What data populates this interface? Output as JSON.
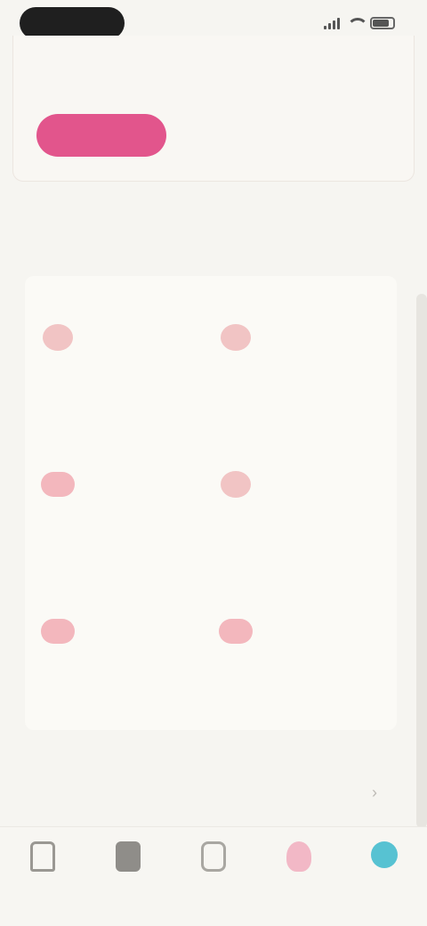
{
  "status_bar": {
    "icons": [
      "signal-icon",
      "wifi-icon",
      "battery-icon"
    ]
  },
  "promo": {
    "line1": "",
    "line2": "",
    "button_label": ""
  },
  "section": {
    "title": "",
    "subtitle": ""
  },
  "tiles": [
    {
      "label": "",
      "icon": "category-icon"
    },
    {
      "label": "",
      "icon": "category-icon"
    },
    {
      "label": "",
      "icon": "category-icon"
    },
    {
      "label": "",
      "icon": "category-icon"
    },
    {
      "label": "",
      "icon": "category-icon"
    },
    {
      "label": "",
      "icon": "category-icon"
    }
  ],
  "info": {
    "line1": "",
    "line2": ""
  },
  "nav": [
    {
      "label": "",
      "icon": "home-icon"
    },
    {
      "label": "",
      "icon": "list-icon"
    },
    {
      "label": "",
      "icon": "box-icon"
    },
    {
      "label": "",
      "icon": "heart-icon"
    },
    {
      "label": "",
      "icon": "profile-icon"
    }
  ],
  "colors": {
    "accent": "#e2558c",
    "tile_icon": "#f1c4c4",
    "active_nav": "#57c2d2",
    "background": "#f6f5f1"
  }
}
